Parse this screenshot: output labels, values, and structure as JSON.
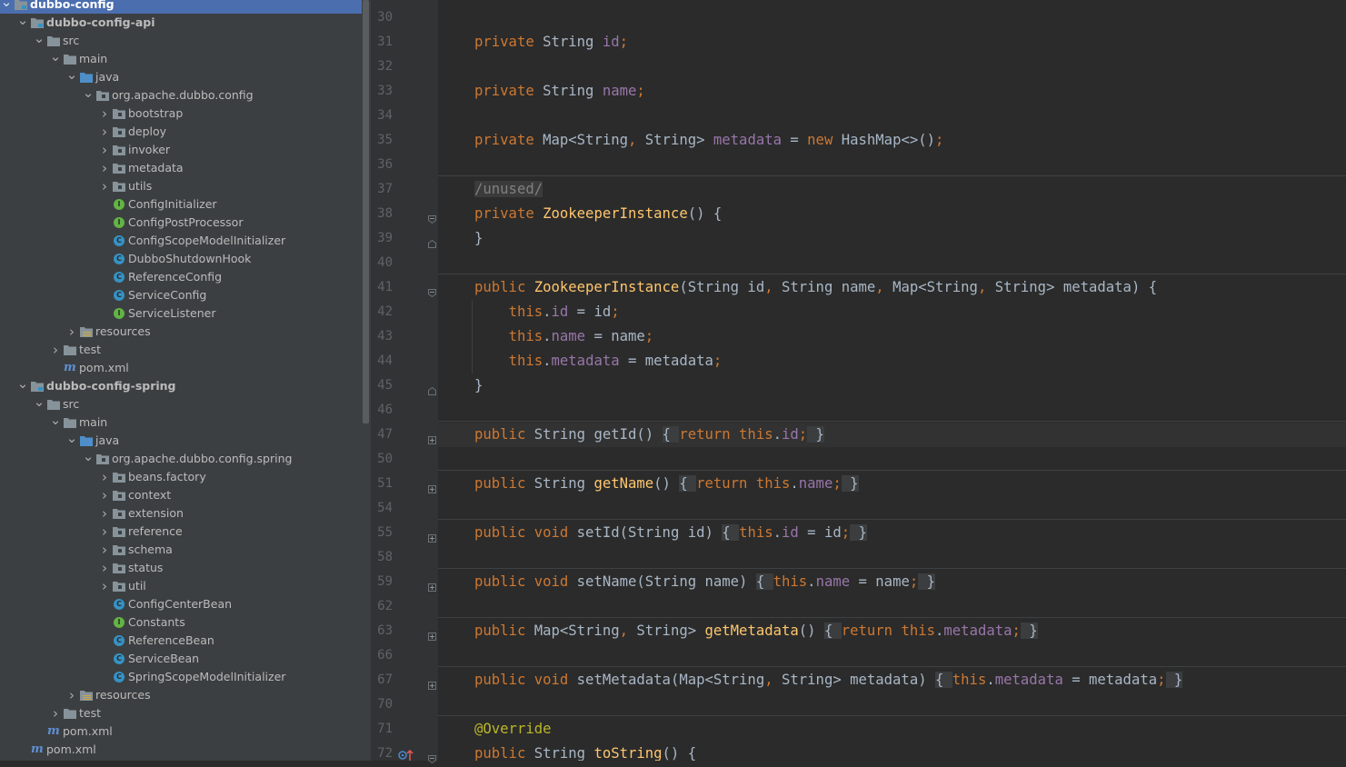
{
  "project_tree": [
    {
      "label": "dubbo-config",
      "icon": "module-folder-icon",
      "depth": 0,
      "expanded": true,
      "selected": true,
      "bold": true
    },
    {
      "label": "dubbo-config-api",
      "icon": "module-folder-icon",
      "depth": 1,
      "expanded": true,
      "bold": true
    },
    {
      "label": "src",
      "icon": "folder-icon",
      "depth": 2,
      "expanded": true
    },
    {
      "label": "main",
      "icon": "folder-icon",
      "depth": 3,
      "expanded": true
    },
    {
      "label": "java",
      "icon": "source-folder-icon",
      "depth": 4,
      "expanded": true
    },
    {
      "label": "org.apache.dubbo.config",
      "icon": "package-icon",
      "depth": 5,
      "expanded": true
    },
    {
      "label": "bootstrap",
      "icon": "package-icon",
      "depth": 6,
      "expanded": false
    },
    {
      "label": "deploy",
      "icon": "package-icon",
      "depth": 6,
      "expanded": false
    },
    {
      "label": "invoker",
      "icon": "package-icon",
      "depth": 6,
      "expanded": false
    },
    {
      "label": "metadata",
      "icon": "package-icon",
      "depth": 6,
      "expanded": false
    },
    {
      "label": "utils",
      "icon": "package-icon",
      "depth": 6,
      "expanded": false
    },
    {
      "label": "ConfigInitializer",
      "icon": "interface-icon",
      "depth": 6
    },
    {
      "label": "ConfigPostProcessor",
      "icon": "interface-icon",
      "depth": 6
    },
    {
      "label": "ConfigScopeModelInitializer",
      "icon": "class-icon",
      "depth": 6
    },
    {
      "label": "DubboShutdownHook",
      "icon": "class-icon",
      "depth": 6
    },
    {
      "label": "ReferenceConfig",
      "icon": "class-icon",
      "depth": 6
    },
    {
      "label": "ServiceConfig",
      "icon": "class-icon",
      "depth": 6
    },
    {
      "label": "ServiceListener",
      "icon": "interface-icon",
      "depth": 6
    },
    {
      "label": "resources",
      "icon": "resources-folder-icon",
      "depth": 4,
      "expanded": false
    },
    {
      "label": "test",
      "icon": "folder-icon",
      "depth": 3,
      "expanded": false
    },
    {
      "label": "pom.xml",
      "icon": "maven-icon",
      "depth": 3
    },
    {
      "label": "dubbo-config-spring",
      "icon": "module-folder-icon",
      "depth": 1,
      "expanded": true,
      "bold": true
    },
    {
      "label": "src",
      "icon": "folder-icon",
      "depth": 2,
      "expanded": true
    },
    {
      "label": "main",
      "icon": "folder-icon",
      "depth": 3,
      "expanded": true
    },
    {
      "label": "java",
      "icon": "source-folder-icon",
      "depth": 4,
      "expanded": true
    },
    {
      "label": "org.apache.dubbo.config.spring",
      "icon": "package-icon",
      "depth": 5,
      "expanded": true
    },
    {
      "label": "beans.factory",
      "icon": "package-icon",
      "depth": 6,
      "expanded": false
    },
    {
      "label": "context",
      "icon": "package-icon",
      "depth": 6,
      "expanded": false
    },
    {
      "label": "extension",
      "icon": "package-icon",
      "depth": 6,
      "expanded": false
    },
    {
      "label": "reference",
      "icon": "package-icon",
      "depth": 6,
      "expanded": false
    },
    {
      "label": "schema",
      "icon": "package-icon",
      "depth": 6,
      "expanded": false
    },
    {
      "label": "status",
      "icon": "package-icon",
      "depth": 6,
      "expanded": false
    },
    {
      "label": "util",
      "icon": "package-icon",
      "depth": 6,
      "expanded": false
    },
    {
      "label": "ConfigCenterBean",
      "icon": "class-icon",
      "depth": 6
    },
    {
      "label": "Constants",
      "icon": "interface-icon",
      "depth": 6
    },
    {
      "label": "ReferenceBean",
      "icon": "class-icon",
      "depth": 6
    },
    {
      "label": "ServiceBean",
      "icon": "class-icon",
      "depth": 6
    },
    {
      "label": "SpringScopeModelInitializer",
      "icon": "class-icon",
      "depth": 6
    },
    {
      "label": "resources",
      "icon": "resources-folder-icon",
      "depth": 4,
      "expanded": false
    },
    {
      "label": "test",
      "icon": "folder-icon",
      "depth": 3,
      "expanded": false
    },
    {
      "label": "pom.xml",
      "icon": "maven-icon",
      "depth": 2
    },
    {
      "label": "pom.xml",
      "icon": "maven-icon",
      "depth": 1
    }
  ],
  "editor_lines": [
    {
      "n": "30",
      "tokens": []
    },
    {
      "n": "31",
      "tokens": [
        [
          "kw",
          "private "
        ],
        [
          "t",
          "String "
        ],
        [
          "fld",
          "id"
        ],
        [
          "kw",
          ";"
        ]
      ]
    },
    {
      "n": "32",
      "tokens": []
    },
    {
      "n": "33",
      "tokens": [
        [
          "kw",
          "private "
        ],
        [
          "t",
          "String "
        ],
        [
          "fld",
          "name"
        ],
        [
          "kw",
          ";"
        ]
      ]
    },
    {
      "n": "34",
      "tokens": []
    },
    {
      "n": "35",
      "tokens": [
        [
          "kw",
          "private "
        ],
        [
          "t",
          "Map<String"
        ],
        [
          "kw",
          ", "
        ],
        [
          "t",
          "String> "
        ],
        [
          "fld",
          "metadata"
        ],
        [
          "t",
          " = "
        ],
        [
          "kw",
          "new "
        ],
        [
          "t",
          "HashMap<>()"
        ],
        [
          "kw",
          ";"
        ]
      ]
    },
    {
      "n": "36",
      "tokens": [],
      "sep_after": true
    },
    {
      "n": "37",
      "tokens": [
        [
          "cmt",
          "/unused/"
        ]
      ]
    },
    {
      "n": "38",
      "tokens": [
        [
          "kw",
          "private "
        ],
        [
          "fn",
          "ZookeeperInstance"
        ],
        [
          "t",
          "() {"
        ]
      ],
      "fold": "open"
    },
    {
      "n": "39",
      "tokens": [
        [
          "t",
          "}"
        ]
      ],
      "fold": "close"
    },
    {
      "n": "40",
      "tokens": [],
      "sep_after": true
    },
    {
      "n": "41",
      "tokens": [
        [
          "kw",
          "public "
        ],
        [
          "fn",
          "ZookeeperInstance"
        ],
        [
          "t",
          "(String id"
        ],
        [
          "kw",
          ", "
        ],
        [
          "t",
          "String name"
        ],
        [
          "kw",
          ", "
        ],
        [
          "t",
          "Map<String"
        ],
        [
          "kw",
          ", "
        ],
        [
          "t",
          "String> metadata) {"
        ]
      ],
      "fold": "open"
    },
    {
      "n": "42",
      "tokens": [
        [
          "t",
          "    "
        ],
        [
          "kw",
          "this"
        ],
        [
          "t",
          "."
        ],
        [
          "fld",
          "id"
        ],
        [
          "t",
          " = id"
        ],
        [
          "kw",
          ";"
        ]
      ]
    },
    {
      "n": "43",
      "tokens": [
        [
          "t",
          "    "
        ],
        [
          "kw",
          "this"
        ],
        [
          "t",
          "."
        ],
        [
          "fld",
          "name"
        ],
        [
          "t",
          " = name"
        ],
        [
          "kw",
          ";"
        ]
      ]
    },
    {
      "n": "44",
      "tokens": [
        [
          "t",
          "    "
        ],
        [
          "kw",
          "this"
        ],
        [
          "t",
          "."
        ],
        [
          "fld",
          "metadata"
        ],
        [
          "t",
          " = metadata"
        ],
        [
          "kw",
          ";"
        ]
      ]
    },
    {
      "n": "45",
      "tokens": [
        [
          "t",
          "}"
        ]
      ],
      "fold": "close"
    },
    {
      "n": "46",
      "tokens": [],
      "sep_after": true
    },
    {
      "n": "47",
      "tokens": [
        [
          "kw",
          "public "
        ],
        [
          "t",
          "String "
        ],
        [
          "t",
          "getId() "
        ],
        [
          "fb",
          "{ "
        ],
        [
          "kw",
          "return this"
        ],
        [
          "t",
          "."
        ],
        [
          "fld",
          "id"
        ],
        [
          "kw",
          ";"
        ],
        [
          "fb",
          " }"
        ]
      ],
      "fold": "plus",
      "current": true
    },
    {
      "n": "50",
      "tokens": [],
      "sep_after": true
    },
    {
      "n": "51",
      "tokens": [
        [
          "kw",
          "public "
        ],
        [
          "t",
          "String "
        ],
        [
          "fn",
          "getName"
        ],
        [
          "t",
          "() "
        ],
        [
          "fb",
          "{ "
        ],
        [
          "kw",
          "return this"
        ],
        [
          "t",
          "."
        ],
        [
          "fld",
          "name"
        ],
        [
          "kw",
          ";"
        ],
        [
          "fb",
          " }"
        ]
      ],
      "fold": "plus"
    },
    {
      "n": "54",
      "tokens": [],
      "sep_after": true
    },
    {
      "n": "55",
      "tokens": [
        [
          "kw",
          "public void "
        ],
        [
          "t",
          "setId(String id) "
        ],
        [
          "fb",
          "{ "
        ],
        [
          "kw",
          "this"
        ],
        [
          "t",
          "."
        ],
        [
          "fld",
          "id"
        ],
        [
          "t",
          " = id"
        ],
        [
          "kw",
          ";"
        ],
        [
          "fb",
          " }"
        ]
      ],
      "fold": "plus"
    },
    {
      "n": "58",
      "tokens": [],
      "sep_after": true
    },
    {
      "n": "59",
      "tokens": [
        [
          "kw",
          "public void "
        ],
        [
          "t",
          "setName(String name) "
        ],
        [
          "fb",
          "{ "
        ],
        [
          "kw",
          "this"
        ],
        [
          "t",
          "."
        ],
        [
          "fld",
          "name"
        ],
        [
          "t",
          " = name"
        ],
        [
          "kw",
          ";"
        ],
        [
          "fb",
          " }"
        ]
      ],
      "fold": "plus"
    },
    {
      "n": "62",
      "tokens": [],
      "sep_after": true
    },
    {
      "n": "63",
      "tokens": [
        [
          "kw",
          "public "
        ],
        [
          "t",
          "Map<String"
        ],
        [
          "kw",
          ", "
        ],
        [
          "t",
          "String> "
        ],
        [
          "fn",
          "getMetadata"
        ],
        [
          "t",
          "() "
        ],
        [
          "fb",
          "{ "
        ],
        [
          "kw",
          "return this"
        ],
        [
          "t",
          "."
        ],
        [
          "fld",
          "metadata"
        ],
        [
          "kw",
          ";"
        ],
        [
          "fb",
          " }"
        ]
      ],
      "fold": "plus"
    },
    {
      "n": "66",
      "tokens": [],
      "sep_after": true
    },
    {
      "n": "67",
      "tokens": [
        [
          "kw",
          "public void "
        ],
        [
          "t",
          "setMetadata(Map<String"
        ],
        [
          "kw",
          ", "
        ],
        [
          "t",
          "String> metadata) "
        ],
        [
          "fb",
          "{ "
        ],
        [
          "kw",
          "this"
        ],
        [
          "t",
          "."
        ],
        [
          "fld",
          "metadata"
        ],
        [
          "t",
          " = metadata"
        ],
        [
          "kw",
          ";"
        ],
        [
          "fb",
          " }"
        ]
      ],
      "fold": "plus"
    },
    {
      "n": "70",
      "tokens": [],
      "sep_after": true
    },
    {
      "n": "71",
      "tokens": [
        [
          "ann",
          "@Override"
        ]
      ]
    },
    {
      "n": "72",
      "tokens": [
        [
          "kw",
          "public "
        ],
        [
          "t",
          "String "
        ],
        [
          "fn",
          "toString"
        ],
        [
          "t",
          "() {"
        ]
      ],
      "fold": "open",
      "gutter_icon": "override-method-icon"
    }
  ],
  "colors": {
    "keyword": "#cc7832",
    "field": "#9876aa",
    "function": "#ffc66d",
    "annotation": "#bbb529",
    "text": "#a9b7c6",
    "selection": "#4b6eaf"
  }
}
